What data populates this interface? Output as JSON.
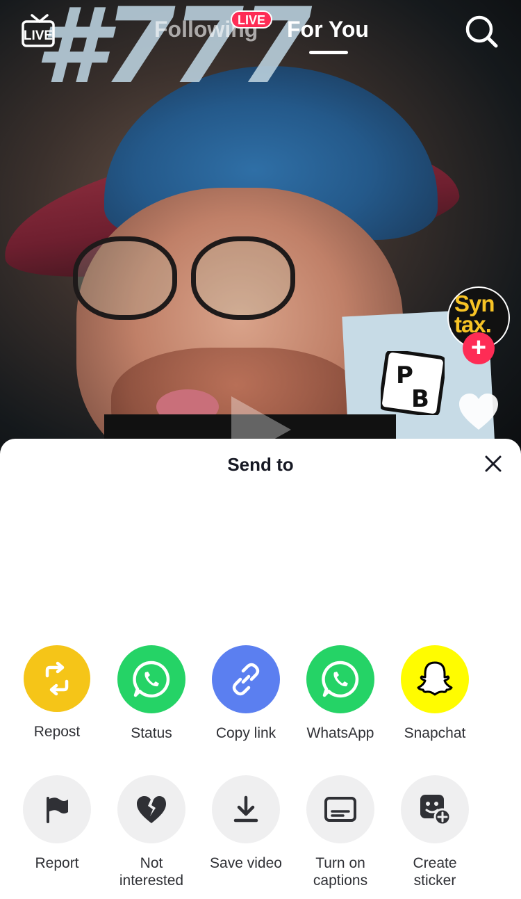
{
  "top_bar": {
    "live_icon_label": "LIVE",
    "tabs": [
      {
        "label": "Following",
        "badge": "LIVE"
      },
      {
        "label": "For You"
      }
    ],
    "icons": [
      "live-tv-icon",
      "search-icon"
    ]
  },
  "video": {
    "overlay_text": "#777",
    "card_text": "PB"
  },
  "creator": {
    "avatar_text": "Syn tax."
  },
  "right_rail": {
    "icons": [
      "heart-icon"
    ]
  },
  "sheet": {
    "title": "Send to",
    "share_row": [
      {
        "label": "Repost",
        "icon": "repost-icon",
        "color": "#f5c518"
      },
      {
        "label": "Status",
        "icon": "whatsapp-icon",
        "color": "#25d366"
      },
      {
        "label": "Copy link",
        "icon": "link-icon",
        "color": "#5b7ff0"
      },
      {
        "label": "WhatsApp",
        "icon": "whatsapp-icon",
        "color": "#25d366"
      },
      {
        "label": "Snapchat",
        "icon": "snapchat-ghost-icon",
        "color": "#fffc00"
      }
    ],
    "action_row": [
      {
        "label": "Report",
        "icon": "flag-icon"
      },
      {
        "label": "Not interested",
        "icon": "broken-heart-icon"
      },
      {
        "label": "Save video",
        "icon": "download-icon"
      },
      {
        "label": "Turn on captions",
        "icon": "captions-icon"
      },
      {
        "label": "Create sticker",
        "icon": "sticker-icon"
      }
    ]
  },
  "colors": {
    "accent": "#fe2c55",
    "sheet_bg": "#ffffff",
    "action_circle": "#efeff0"
  }
}
